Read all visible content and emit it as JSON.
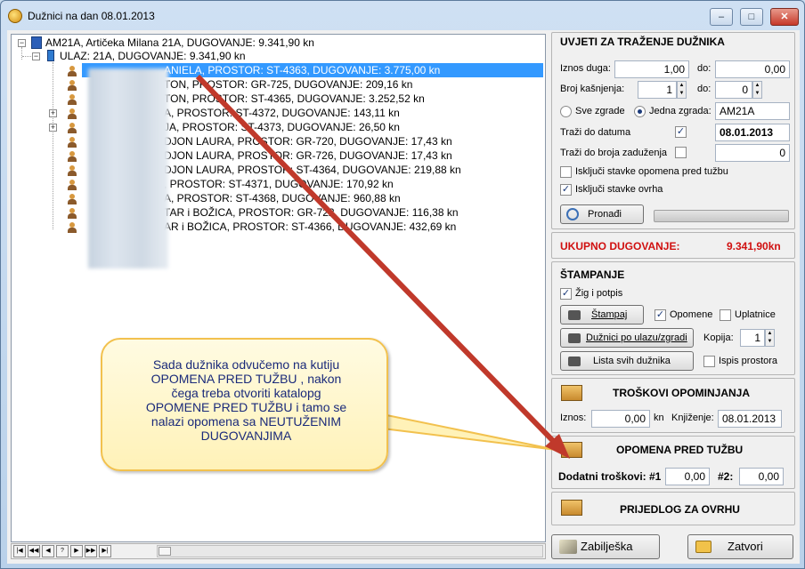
{
  "window": {
    "title": "Dužnici na dan 08.01.2013",
    "minimize": "–",
    "maximize": "□",
    "close": "✕"
  },
  "tree": {
    "root": "AM21A,  Artičeka Milana 21A,   DUGOVANJE: 9.341,90 kn",
    "entrance": "ULAZ: 21A,   DUGOVANJE: 9.341,90 kn",
    "items": [
      {
        "text": "ANIELA,   PROSTOR: ST-4363,   DUGOVANJE: 3.775,00 kn"
      },
      {
        "text": "TON,   PROSTOR: GR-725,   DUGOVANJE: 209,16 kn"
      },
      {
        "text": "TON,   PROSTOR: ST-4365,   DUGOVANJE: 3.252,52 kn"
      },
      {
        "text": "A,   PROSTOR: ST-4372,   DUGOVANJE: 143,11 kn"
      },
      {
        "text": "JA,   PROSTOR: ST-4373,   DUGOVANJE: 26,50 kn"
      },
      {
        "text": "DJON LAURA,   PROSTOR: GR-720,   DUGOVANJE: 17,43 kn"
      },
      {
        "text": "DJON LAURA,   PROSTOR: GR-726,   DUGOVANJE: 17,43 kn"
      },
      {
        "text": "DJON LAURA,   PROSTOR: ST-4364,   DUGOVANJE: 219,88 kn"
      },
      {
        "text": ",   PROSTOR: ST-4371,   DUGOVANJE: 170,92 kn"
      },
      {
        "text": "A,   PROSTOR: ST-4368,   DUGOVANJE: 960,88 kn"
      },
      {
        "text": "TAR i BOŽICA,   PROSTOR: GR-722,   DUGOVANJE: 116,38 kn"
      },
      {
        "text": "AR i BOŽICA,   PROSTOR: ST-4366,   DUGOVANJE: 432,69 kn"
      }
    ]
  },
  "search": {
    "title": "UVJETI ZA TRAŽENJE DUŽNIKA",
    "iznos_label": "Iznos duga:",
    "iznos_from": "1,00",
    "do_label": "do:",
    "iznos_to": "0,00",
    "kasnjenja_label": "Broj kašnjenja:",
    "kasnjenja_from": "1",
    "kasnjenja_to": "0",
    "sve_zgrade": "Sve zgrade",
    "jedna_zgrada": "Jedna zgrada:",
    "zgrada_value": "AM21A",
    "trazi_datum_label": "Traži do datuma",
    "datum_value": "08.01.2013",
    "trazi_zaduzenja_label": "Traži do broja zaduženja",
    "zaduzenja_value": "0",
    "iskljuci_opomena": "Isključi stavke opomena pred tužbu",
    "iskljuci_ovrha": "Isključi stavke ovrha",
    "pronadi": "Pronađi",
    "check_mark": "✓"
  },
  "total": {
    "label": "UKUPNO DUGOVANJE:",
    "value": "9.341,90kn",
    "color": "#d01010"
  },
  "print": {
    "title": "ŠTAMPANJE",
    "zig": "Žig i potpis",
    "stampaj": "Štampaj",
    "opomene": "Opomene",
    "uplatnice": "Uplatnice",
    "duznici_po_ulazu": "Dužnici po ulazu/zgradi",
    "kopija_label": "Kopija:",
    "kopija_value": "1",
    "lista_svih": "Lista svih dužnika",
    "ispis_prostora": "Ispis prostora"
  },
  "costs": {
    "title": "TROŠKOVI OPOMINJANJA",
    "iznos_label": "Iznos:",
    "iznos_value": "0,00",
    "kn": "kn",
    "knjizenje_label": "Knjiženje:",
    "knjizenje_value": "08.01.2013"
  },
  "warning": {
    "title": "OPOMENA PRED TUŽBU",
    "dodatni_label": "Dodatni troškovi:  #1",
    "v1": "0,00",
    "n2": "#2:",
    "v2": "0,00"
  },
  "ovrha": {
    "title": "PRIJEDLOG ZA OVRHU"
  },
  "bottom": {
    "zabiljeska": "Zabilješka",
    "zatvori": "Zatvori"
  },
  "callout": {
    "text": "Sada dužnika odvučemo na kutiju\nOPOMENA PRED TUŽBU , nakon\nčega treba otvoriti katalopg\nOPOMENE PRED TUŽBU i tamo se\nnalazi opomena sa NEUTUŽENIM\nDUGOVANJIMA"
  },
  "nav": {
    "first": "|◀",
    "prevpage": "◀◀",
    "prev": "◀",
    "rec": "?",
    "next": "▶",
    "nextpage": "▶▶",
    "last": "▶|"
  }
}
